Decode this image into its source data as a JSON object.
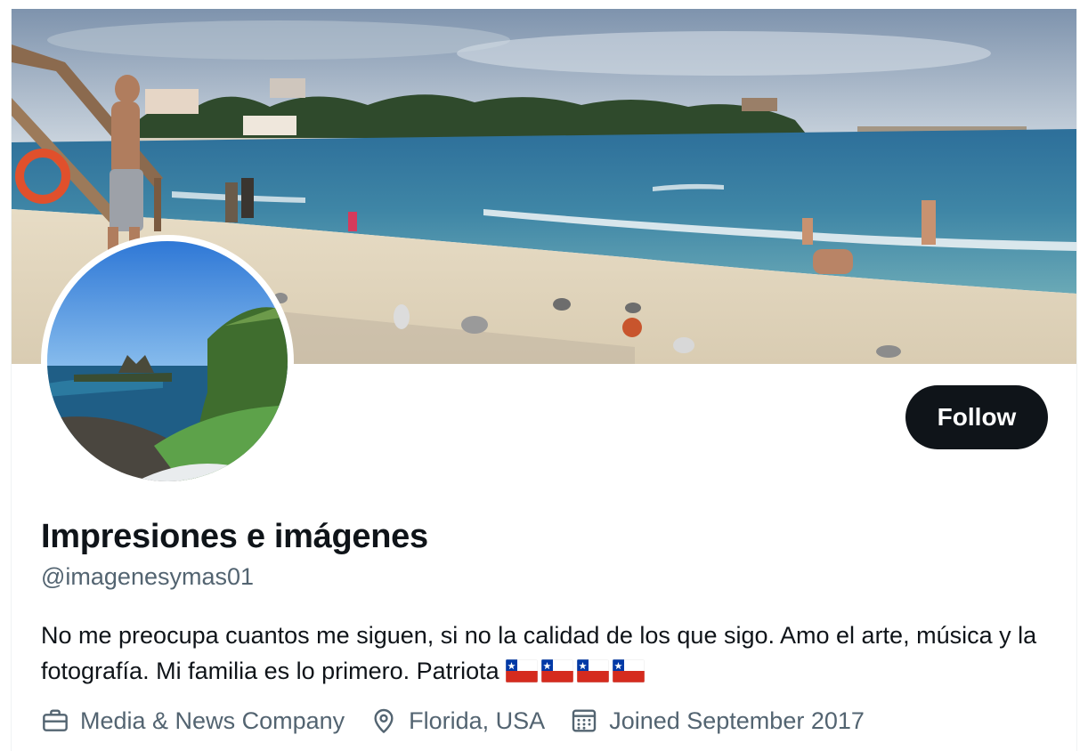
{
  "profile": {
    "display_name": "Impresiones e imágenes",
    "handle": "@imagenesymas01",
    "bio_text": "No me preocupa cuantos me siguen, si no la calidad de los que sigo. Amo el arte, música y la fotografía. Mi familia es lo primero. Patriota",
    "bio_flags": [
      "chile-flag-icon",
      "chile-flag-icon",
      "chile-flag-icon",
      "chile-flag-icon"
    ],
    "follow_label": "Follow",
    "category": "Media & News Company",
    "location": "Florida, USA",
    "joined": "Joined September 2017"
  },
  "icons": {
    "category": "briefcase-icon",
    "location": "location-pin-icon",
    "joined": "calendar-icon"
  },
  "colors": {
    "primary_text": "#0f1419",
    "secondary_text": "#536471",
    "follow_button_bg": "#0f1419",
    "follow_button_text": "#ffffff"
  }
}
